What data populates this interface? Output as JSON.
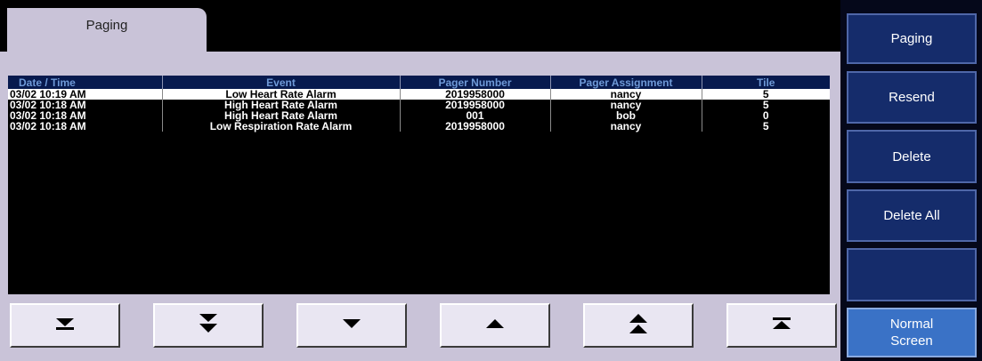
{
  "tab": {
    "label": "Paging"
  },
  "table": {
    "headers": [
      "Date / Time",
      "Event",
      "Pager Number",
      "Pager Assignment",
      "Tile"
    ],
    "rows": [
      [
        "03/02  10:19 AM",
        "Low Heart Rate Alarm",
        "2019958000",
        "nancy",
        "5"
      ],
      [
        "03/02  10:18 AM",
        "High Heart Rate Alarm",
        "2019958000",
        "nancy",
        "5"
      ],
      [
        "03/02  10:18 AM",
        "High Heart Rate Alarm",
        "001",
        "bob",
        "0"
      ],
      [
        "03/02  10:18 AM",
        "Low Respiration Rate Alarm",
        "2019958000",
        "nancy",
        "5"
      ]
    ],
    "selected_row": 0
  },
  "nav_buttons": [
    {
      "icon": "scroll-bottom-icon"
    },
    {
      "icon": "page-down-icon"
    },
    {
      "icon": "arrow-down-icon"
    },
    {
      "icon": "arrow-up-icon"
    },
    {
      "icon": "page-up-icon"
    },
    {
      "icon": "scroll-top-icon"
    }
  ],
  "sidebar": {
    "paging_label": "Paging",
    "resend_label": "Resend",
    "delete_label": "Delete",
    "delete_all_label": "Delete All",
    "empty_label": "",
    "normal_screen_line1": "Normal",
    "normal_screen_line2": "Screen"
  },
  "colors": {
    "frame": "#c9c3d8",
    "header_bg": "#071a4e",
    "header_text": "#6f9ad8",
    "side_button": "#152c6b",
    "side_button_active": "#3a72c6"
  }
}
